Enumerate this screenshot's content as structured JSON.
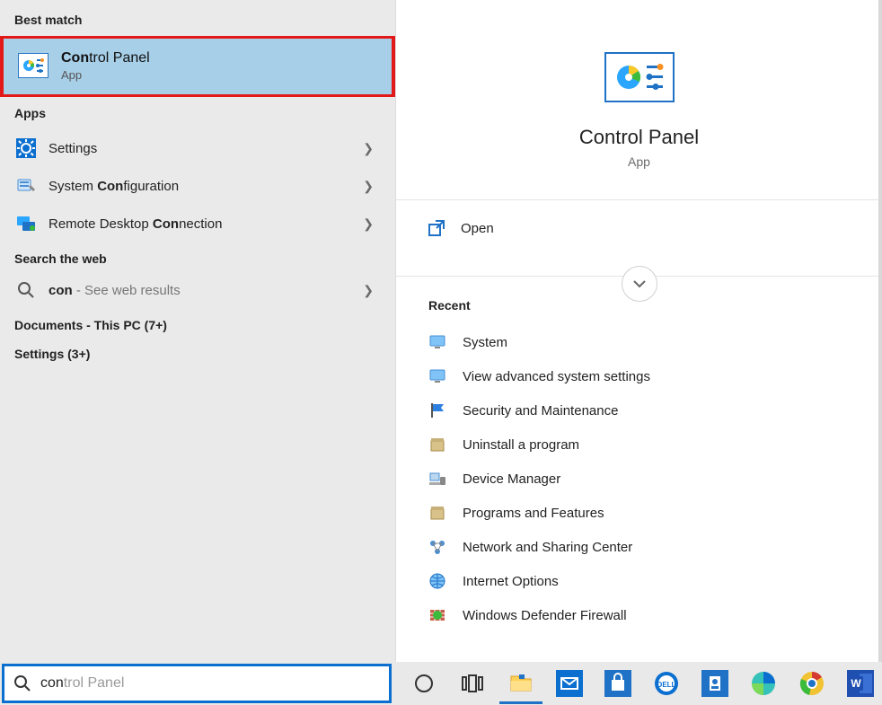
{
  "left": {
    "best_match_label": "Best match",
    "best_match": {
      "title_pre": "Con",
      "title_rest": "trol Panel",
      "subtitle": "App"
    },
    "apps_label": "Apps",
    "apps": [
      {
        "label": "Settings"
      },
      {
        "label_pre": "System ",
        "label_bold": "Con",
        "label_post": "figuration"
      },
      {
        "label_pre": "Remote Desktop ",
        "label_bold": "Con",
        "label_post": "nection"
      }
    ],
    "web_label": "Search the web",
    "web": {
      "prefix": "con",
      "suffix": " - See web results"
    },
    "docs_label": "Documents - This PC (7+)",
    "settings_label": "Settings (3+)"
  },
  "right": {
    "title": "Control Panel",
    "subtitle": "App",
    "open_label": "Open",
    "recent_label": "Recent",
    "recent_items": [
      "System",
      "View advanced system settings",
      "Security and Maintenance",
      "Uninstall a program",
      "Device Manager",
      "Programs and Features",
      "Network and Sharing Center",
      "Internet Options",
      "Windows Defender Firewall"
    ]
  },
  "search": {
    "typed": "con",
    "ghost": "trol Panel"
  },
  "taskbar_apps": [
    "cortana",
    "task-view",
    "file-explorer",
    "mail",
    "store",
    "dell",
    "microsoft-store",
    "edge",
    "chrome",
    "word"
  ]
}
